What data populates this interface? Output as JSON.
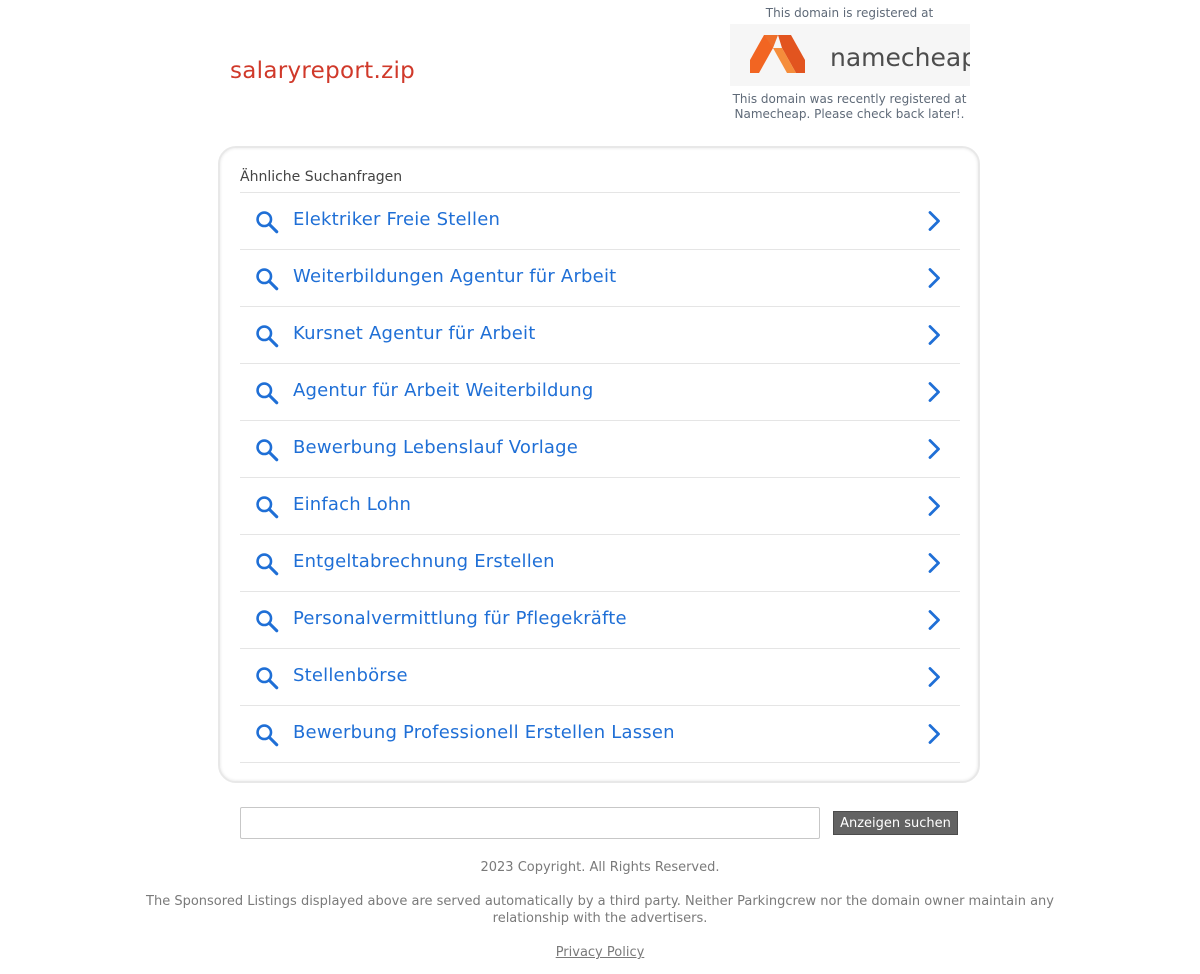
{
  "header": {
    "domain_title": "salaryreport.zip",
    "registrar_intro": "This domain is registered at",
    "registrar_logo_text": "namecheap",
    "registrar_note": "This domain was recently registered at Namecheap. Please check back later!."
  },
  "related": {
    "heading": "Ähnliche Suchanfragen",
    "items": [
      {
        "label": "Elektriker Freie Stellen"
      },
      {
        "label": "Weiterbildungen Agentur für Arbeit"
      },
      {
        "label": "Kursnet Agentur für Arbeit"
      },
      {
        "label": "Agentur für Arbeit Weiterbildung"
      },
      {
        "label": "Bewerbung Lebenslauf Vorlage"
      },
      {
        "label": "Einfach Lohn"
      },
      {
        "label": "Entgeltabrechnung Erstellen"
      },
      {
        "label": "Personalvermittlung für Pflegekräfte"
      },
      {
        "label": "Stellenbörse"
      },
      {
        "label": "Bewerbung Professionell Erstellen Lassen"
      }
    ]
  },
  "search": {
    "value": "",
    "button_label": "Anzeigen suchen"
  },
  "footer": {
    "copyright": "2023 Copyright. All Rights Reserved.",
    "disclaimer": "The Sponsored Listings displayed above are served automatically by a third party. Neither Parkingcrew nor the domain owner maintain any relationship with the advertisers.",
    "privacy_label": "Privacy Policy"
  },
  "colors": {
    "domain_title": "#d0392a",
    "link": "#1f6fd6",
    "logo_orange": "#f26522",
    "button_bg": "#636363"
  },
  "icons": {
    "link_leading": "search-icon",
    "link_trailing": "chevron-right-icon"
  }
}
